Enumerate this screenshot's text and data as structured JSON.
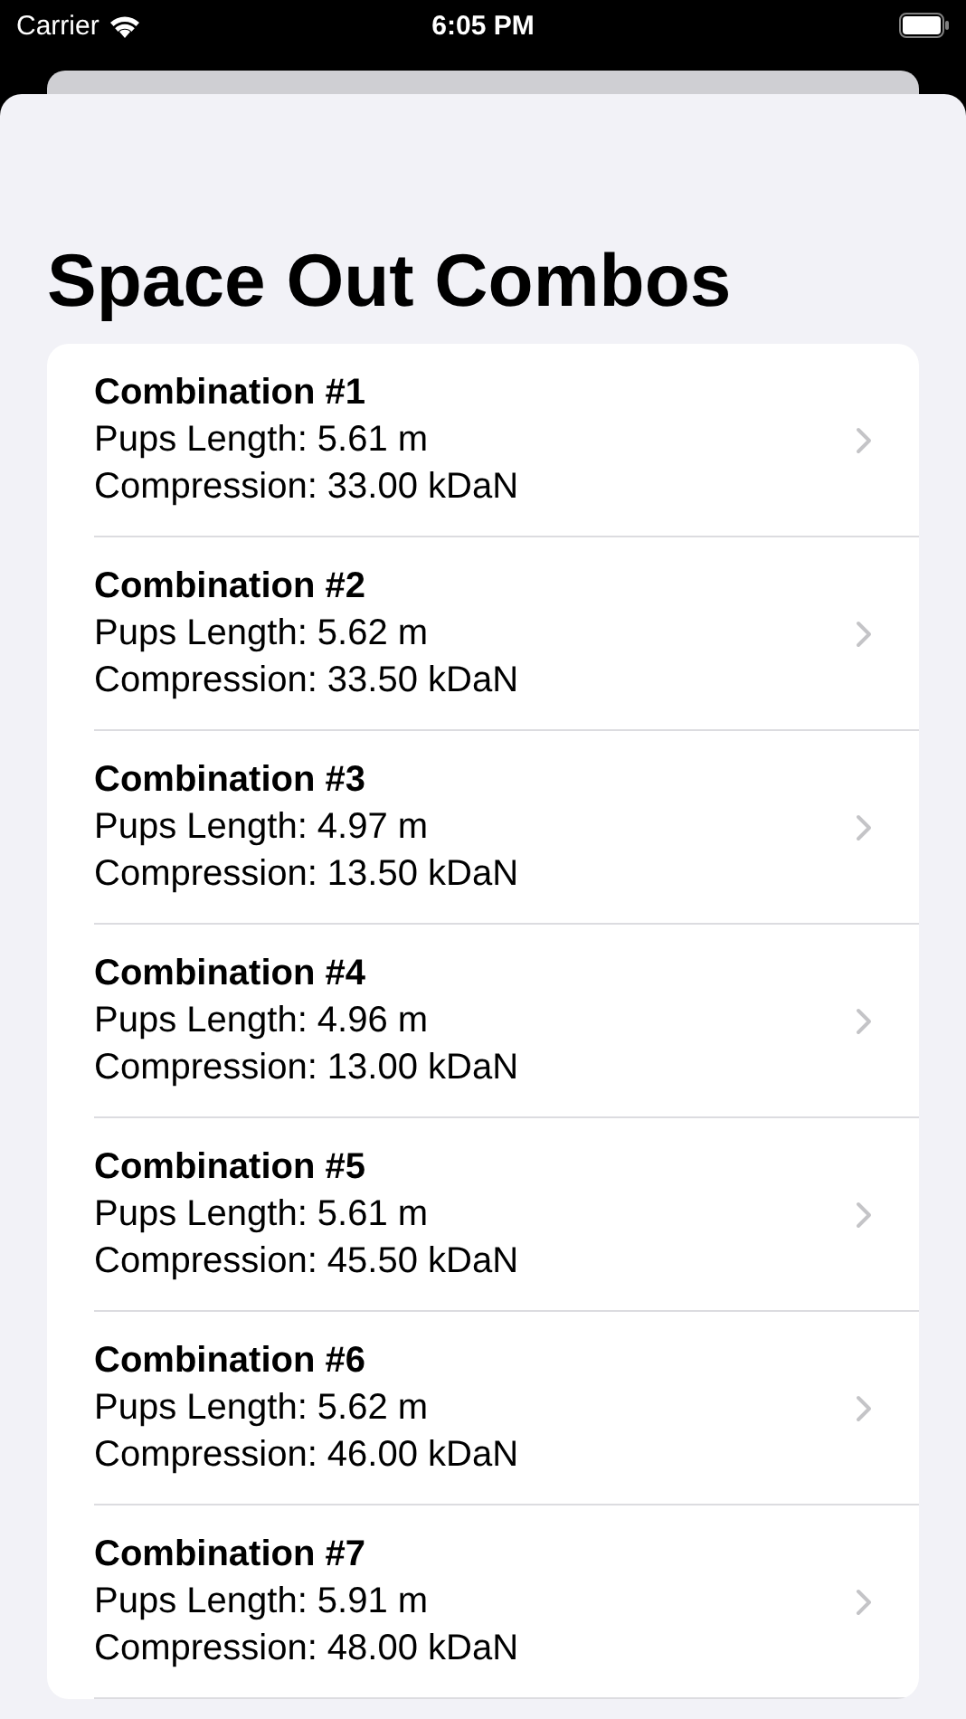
{
  "status_bar": {
    "carrier": "Carrier",
    "time": "6:05 PM"
  },
  "title": "Space Out Combos",
  "combinations": [
    {
      "name": "Combination #1",
      "length": "Pups Length: 5.61 m",
      "compression": "Compression: 33.00 kDaN"
    },
    {
      "name": "Combination #2",
      "length": "Pups Length: 5.62 m",
      "compression": "Compression: 33.50 kDaN"
    },
    {
      "name": "Combination #3",
      "length": "Pups Length: 4.97 m",
      "compression": "Compression: 13.50 kDaN"
    },
    {
      "name": "Combination #4",
      "length": "Pups Length: 4.96 m",
      "compression": "Compression: 13.00 kDaN"
    },
    {
      "name": "Combination #5",
      "length": "Pups Length: 5.61 m",
      "compression": "Compression: 45.50 kDaN"
    },
    {
      "name": "Combination #6",
      "length": "Pups Length: 5.62 m",
      "compression": "Compression: 46.00 kDaN"
    },
    {
      "name": "Combination #7",
      "length": "Pups Length: 5.91 m",
      "compression": "Compression: 48.00 kDaN"
    }
  ]
}
